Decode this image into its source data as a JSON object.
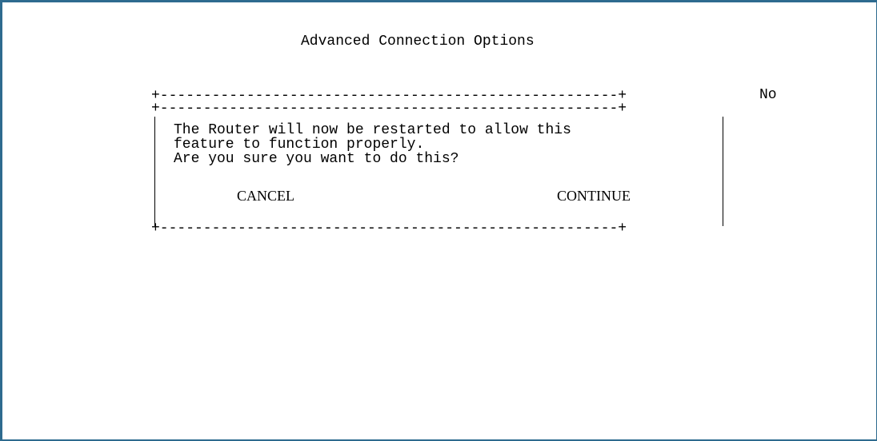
{
  "screen": {
    "title": "Advanced Connection Options",
    "background_value": "No"
  },
  "dialog": {
    "border_top_1": "+-----------------------------------------------------+",
    "border_top_2": "+-----------------------------------------------------+",
    "border_bottom": "+-----------------------------------------------------+",
    "message_lines": [
      "The Router will now be restarted to allow this",
      "feature to function properly.",
      "Are you sure you want to do this?"
    ],
    "cancel_label": "CANCEL",
    "continue_label": "CONTINUE"
  },
  "colors": {
    "frame_border": "#2e6b8f",
    "background": "#ffffff",
    "text": "#000000"
  }
}
